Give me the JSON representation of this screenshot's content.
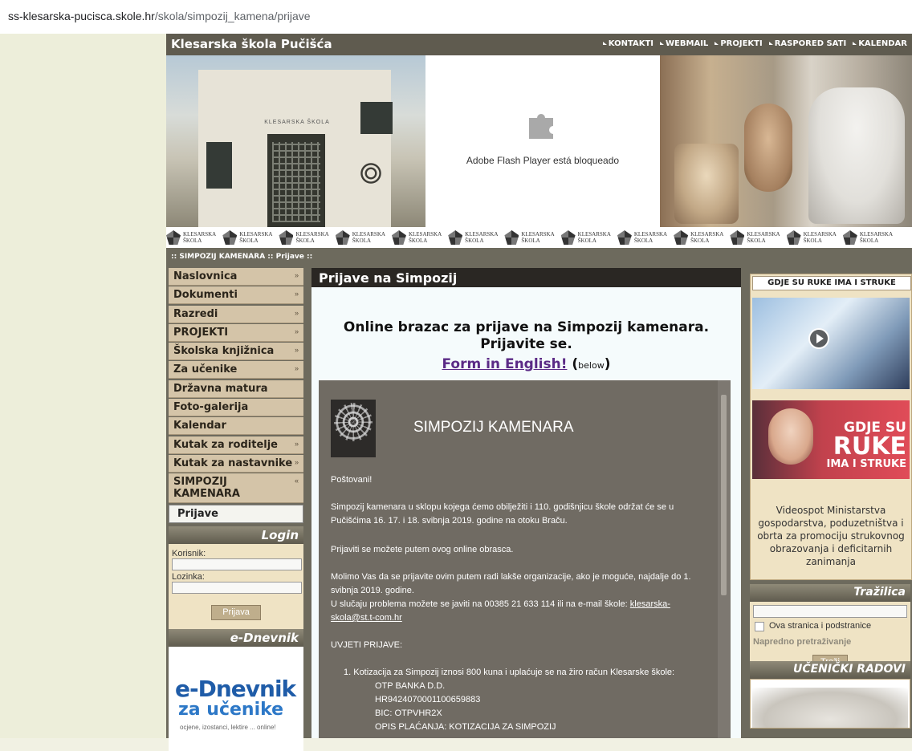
{
  "browser": {
    "url_host": "ss-klesarska-pucisca.skole.hr",
    "url_path": "/skola/simpozij_kamena/prijave"
  },
  "header": {
    "site_name": "Klesarska škola Pučišća",
    "nav": [
      "KONTAKTI",
      "WEBMAIL",
      "PROJEKTI",
      "RASPORED SATI",
      "KALENDAR"
    ]
  },
  "banner": {
    "building_sign": "KLESARSKA ŠKOLA",
    "flash_message": "Adobe Flash Player está bloqueado",
    "logo_text_1": "KLESARSKA",
    "logo_text_2": "ŠKOLA"
  },
  "breadcrumb": ":: SIMPOZIJ KAMENARA :: Prijave ::",
  "sidebar": {
    "items": [
      {
        "label": "Naslovnica",
        "arrow": "»"
      },
      {
        "label": "Dokumenti",
        "arrow": "»"
      },
      {
        "label": "Razredi",
        "arrow": "»"
      },
      {
        "label": "PROJEKTI",
        "arrow": "»"
      },
      {
        "label": "Školska knjižnica",
        "arrow": "»"
      },
      {
        "label": "Za učenike",
        "arrow": "»"
      },
      {
        "label": "Državna matura",
        "arrow": ""
      },
      {
        "label": "Foto-galerija",
        "arrow": ""
      },
      {
        "label": "Kalendar",
        "arrow": ""
      },
      {
        "label": "Kutak za roditelje",
        "arrow": "»"
      },
      {
        "label": "Kutak za nastavnike",
        "arrow": "»"
      },
      {
        "label": "SIMPOZIJ KAMENARA",
        "arrow": "«"
      },
      {
        "label": "Prijave",
        "arrow": ""
      }
    ]
  },
  "login": {
    "title": "Login",
    "user_label": "Korisnik:",
    "pass_label": "Lozinka:",
    "button": "Prijava"
  },
  "ednevnik": {
    "title": "e-Dnevnik",
    "logo_line1": "e-Dnevnik",
    "logo_line2": "za učenike",
    "logo_line3": "ocjene, izostanci, lektire ... online!"
  },
  "main": {
    "title": "Prijave na Simpozij",
    "form_heading": "Online brazac za prijave na Simpozij kamenara. Prijavite se.",
    "english_link": "Form in English!",
    "english_paren_open": "(",
    "english_below": "below",
    "english_paren_close": ")"
  },
  "form": {
    "title": "SIMPOZIJ KAMENARA",
    "p1": "Poštovani!",
    "p2": "Simpozij kamenara u sklopu kojega ćemo obilježiti i 110. godišnjicu škole održat će se u Pučišćima 16. 17. i 18. svibnja 2019. godine na otoku Braču.",
    "p3": "Prijaviti se možete putem ovog online obrasca.",
    "p4a": "Molimo Vas da se prijavite ovim putem radi lakše organizacije, ako je moguće, najdalje do 1. svibnja 2019. godine.",
    "p4b": "U slučaju problema možete se javiti na 00385 21 633 114 ili na e-mail škole:",
    "email": "klesarska-skola@st.t-com.hr",
    "p5": "UVJETI PRIJAVE:",
    "p6": "1. Kotizacija za Simpozij iznosi 800 kuna i uplaćuje se na žiro račun Klesarske škole:",
    "bank_lines": [
      "OTP BANKA D.D.",
      "HR9424070001100659883",
      "BIC: OTPVHR2X",
      "OPIS PLAĆANJA: KOTIZACIJA ZA SIMPOZIJ"
    ]
  },
  "right": {
    "box_title": "GDJE SU RUKE IMA I STRUKE",
    "video2_text": [
      "GDJE SU",
      "RUKE",
      "IMA I STRUKE"
    ],
    "caption": "Videospot Ministarstva gospodarstva, poduzetništva i obrta za promociju strukovnog obrazovanja i deficitarnih zanimanja",
    "search_title": "Tražilica",
    "search_checkbox": "Ova stranica i podstranice",
    "advanced": "Napredno pretraživanje",
    "search_button": "Traži",
    "student_title": "UČENIČKI RADOVI"
  }
}
